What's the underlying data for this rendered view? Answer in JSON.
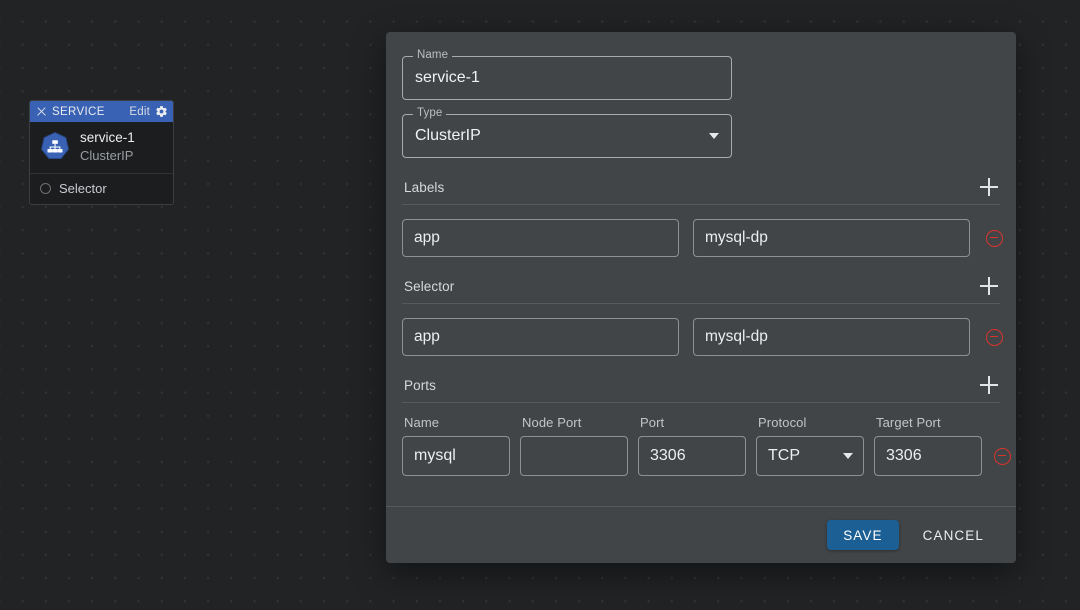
{
  "canvas": {
    "node": {
      "header": {
        "close_icon": "close-icon",
        "title": "SERVICE",
        "edit_label": "Edit",
        "gear_icon": "gear-icon",
        "bg_color": "#3a62b4"
      },
      "icon": "kubernetes-service-icon",
      "name": "service-1",
      "subtitle": "ClusterIP",
      "port": {
        "label": "Selector",
        "dot_icon": "connection-port-icon"
      }
    }
  },
  "dialog": {
    "fields": {
      "name": {
        "label": "Name",
        "value": "service-1"
      },
      "type": {
        "label": "Type",
        "value": "ClusterIP",
        "caret_icon": "chevron-down-icon"
      }
    },
    "sections": {
      "labels": {
        "title": "Labels",
        "add_icon": "plus-icon",
        "rows": [
          {
            "key": "app",
            "value": "mysql-dp",
            "remove_icon": "remove-circle-icon"
          }
        ]
      },
      "selector": {
        "title": "Selector",
        "add_icon": "plus-icon",
        "rows": [
          {
            "key": "app",
            "value": "mysql-dp",
            "remove_icon": "remove-circle-icon"
          }
        ]
      },
      "ports": {
        "title": "Ports",
        "add_icon": "plus-icon",
        "columns": [
          "Name",
          "Node Port",
          "Port",
          "Protocol",
          "Target Port"
        ],
        "rows": [
          {
            "name": "mysql",
            "node_port": "",
            "port": "3306",
            "protocol": "TCP",
            "protocol_caret_icon": "chevron-down-icon",
            "target_port": "3306",
            "remove_icon": "remove-circle-icon"
          }
        ]
      }
    },
    "footer": {
      "save_label": "SAVE",
      "cancel_label": "CANCEL",
      "save_color": "#1b5f94"
    }
  }
}
